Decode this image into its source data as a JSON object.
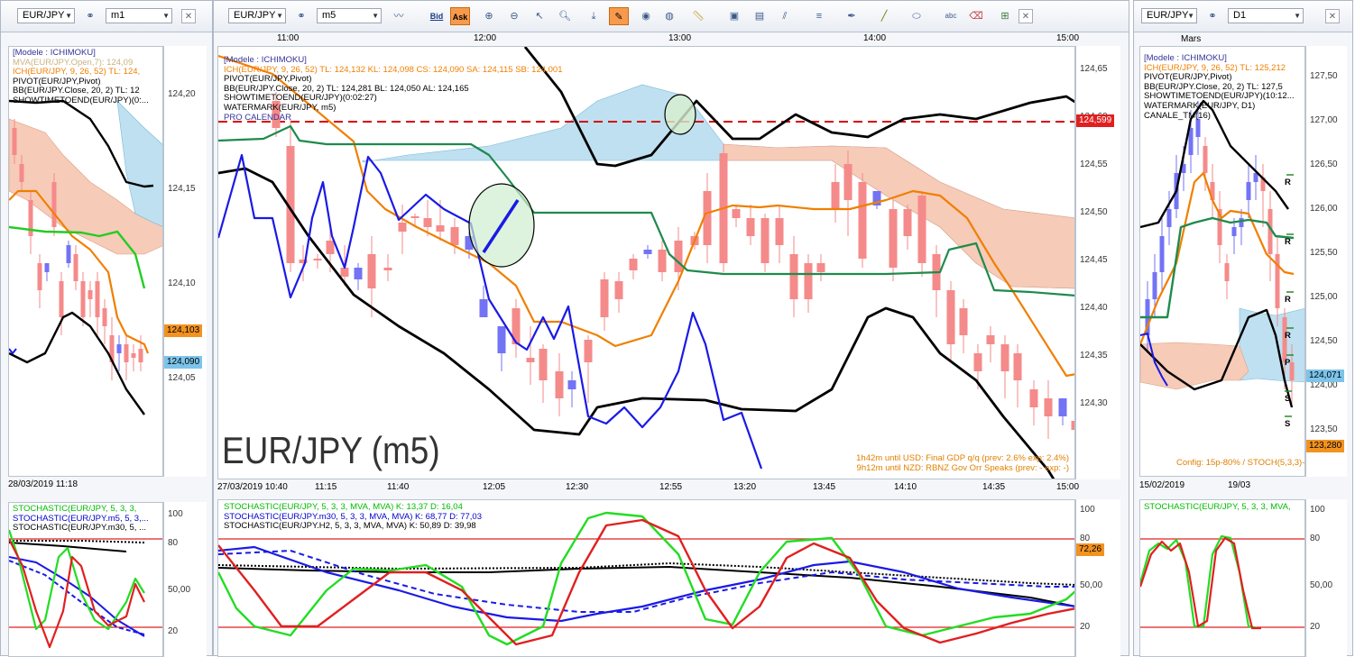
{
  "left": {
    "symbol": "EUR/JPY",
    "timeframe": "m1",
    "xlabels": [
      "28/03/2019 11:18"
    ],
    "yticks": [
      "124,20",
      "124,15",
      "124,10",
      "124,05"
    ],
    "price_tags": {
      "orange": "124,103",
      "blue": "124,090"
    },
    "legend": [
      {
        "text": "[Modele : ICHIMOKU]",
        "color": "#333399"
      },
      {
        "text": "MVA(EUR/JPY.Open,7): 124,09",
        "color": "#c8b483"
      },
      {
        "text": "ICH(EUR/JPY, 9, 26, 52) TL: 124,",
        "color": "#f07f00"
      },
      {
        "text": "PIVOT(EUR/JPY,Pivot)",
        "color": "#000000"
      },
      {
        "text": "BB(EUR/JPY.Close, 20, 2) TL: 12",
        "color": "#000000"
      },
      {
        "text": "SHOWTIMETOEND(EUR/JPY)(0:...",
        "color": "#000000"
      }
    ],
    "osc_legend": [
      {
        "text": "STOCHASTIC(EUR/JPY, 5, 3, 3,",
        "color": "#00bb00"
      },
      {
        "text": "STOCHASTIC(EUR/JPY.m5, 5, 3,...",
        "color": "#0000cc"
      },
      {
        "text": "STOCHASTIC(EUR/JPY.m30, 5, ...",
        "color": "#000000"
      }
    ],
    "osc_yticks": [
      "100",
      "80",
      "50,00",
      "20"
    ]
  },
  "center": {
    "symbol": "EUR/JPY",
    "timeframe": "m5",
    "toolbar_labels": {
      "bid": "Bid",
      "ask": "Ask"
    },
    "top_times": [
      "11:00",
      "12:00",
      "13:00",
      "14:00",
      "15:00"
    ],
    "xlabels": [
      "27/03/2019 10:40",
      "11:15",
      "11:40",
      "12:05",
      "12:30",
      "12:55",
      "13:20",
      "13:45",
      "14:10",
      "14:35",
      "15:00"
    ],
    "yticks": [
      "124,65",
      "124,60",
      "124,55",
      "124,50",
      "124,45",
      "124,40",
      "124,35",
      "124,30"
    ],
    "price_tag": "124,599",
    "watermark": "EUR/JPY (m5)",
    "legend": [
      {
        "text": "[Modele : ICHIMOKU]",
        "color": "#333399"
      },
      {
        "text": "ICH(EUR/JPY, 9, 26, 52)  TL: 124,132   KL: 124,098   CS: 124,090   SA: 124,115   SB: 124,001",
        "color": "#f07f00"
      },
      {
        "text": "PIVOT(EUR/JPY,Pivot)",
        "color": "#000000"
      },
      {
        "text": "BB(EUR/JPY.Close, 20, 2)  TL: 124,281   BL: 124,050   AL: 124,165",
        "color": "#000000"
      },
      {
        "text": "SHOWTIMETOEND(EUR/JPY)(0:02:27)",
        "color": "#000000"
      },
      {
        "text": "WATERMARK(EUR/JPY, m5)",
        "color": "#000000"
      },
      {
        "text": "PRO CALENDAR",
        "color": "#333399"
      }
    ],
    "calendar_notes": [
      "1h42m until USD: Final GDP q/q (prev: 2.6% exp: 2.4%)",
      "9h12m until NZD: RBNZ Gov Orr Speaks (prev: - exp: -)"
    ],
    "osc_legend": [
      {
        "text": "STOCHASTIC(EUR/JPY, 5, 3, 3, MVA, MVA)  K: 13,37   D: 16,04",
        "color": "#00bb00"
      },
      {
        "text": "STOCHASTIC(EUR/JPY.m30, 5, 3, 3, MVA, MVA)  K: 68,77   D: 77,03",
        "color": "#0000cc"
      },
      {
        "text": "STOCHASTIC(EUR/JPY.H2, 5, 3, 3, MVA, MVA)  K: 50,89   D: 39,98",
        "color": "#000000"
      }
    ],
    "osc_yticks": [
      "100",
      "80",
      "50,00",
      "20"
    ],
    "osc_tag": "72,26"
  },
  "right": {
    "symbol": "EUR/JPY",
    "timeframe": "D1",
    "top_label": "Mars",
    "xlabels": [
      "15/02/2019",
      "19/03"
    ],
    "yticks": [
      "127,50",
      "127,00",
      "126,50",
      "126,00",
      "125,50",
      "125,00",
      "124,50",
      "124,00",
      "123,50"
    ],
    "price_tags": {
      "blue": "124,071",
      "orange": "123,280"
    },
    "pivot_labels": [
      "R",
      "R",
      "R",
      "R",
      "P",
      "S",
      "S"
    ],
    "legend": [
      {
        "text": "[Modele : ICHIMOKU]",
        "color": "#333399"
      },
      {
        "text": "ICH(EUR/JPY, 9, 26, 52)  TL: 125,212",
        "color": "#f07f00"
      },
      {
        "text": "PIVOT(EUR/JPY,Pivot)",
        "color": "#000000"
      },
      {
        "text": "BB(EUR/JPY.Close, 20, 2)  TL: 127,5",
        "color": "#000000"
      },
      {
        "text": "SHOWTIMETOEND(EUR/JPY)(10:12...",
        "color": "#000000"
      },
      {
        "text": "WATERMARK(EUR/JPY, D1)",
        "color": "#000000"
      },
      {
        "text": "CANALE_TM(16)",
        "color": "#000000"
      }
    ],
    "config_note": "Config: 15p-80% / STOCH(5,3,3)-100%",
    "osc_legend": [
      {
        "text": "STOCHASTIC(EUR/JPY, 5, 3, 3, MVA,",
        "color": "#00bb00"
      }
    ],
    "osc_yticks": [
      "100",
      "80",
      "50,00",
      "20"
    ]
  },
  "colors": {
    "bull": "#7373f5",
    "bear": "#f58a8a",
    "tenkan": "#f07f00",
    "kijun": "#1f8a4c",
    "blue": "#1a1ae6",
    "bb": "#000000",
    "cloud_up": "#bfe0f0",
    "cloud_dn": "#f6cbb8",
    "resist": "#d60000"
  }
}
